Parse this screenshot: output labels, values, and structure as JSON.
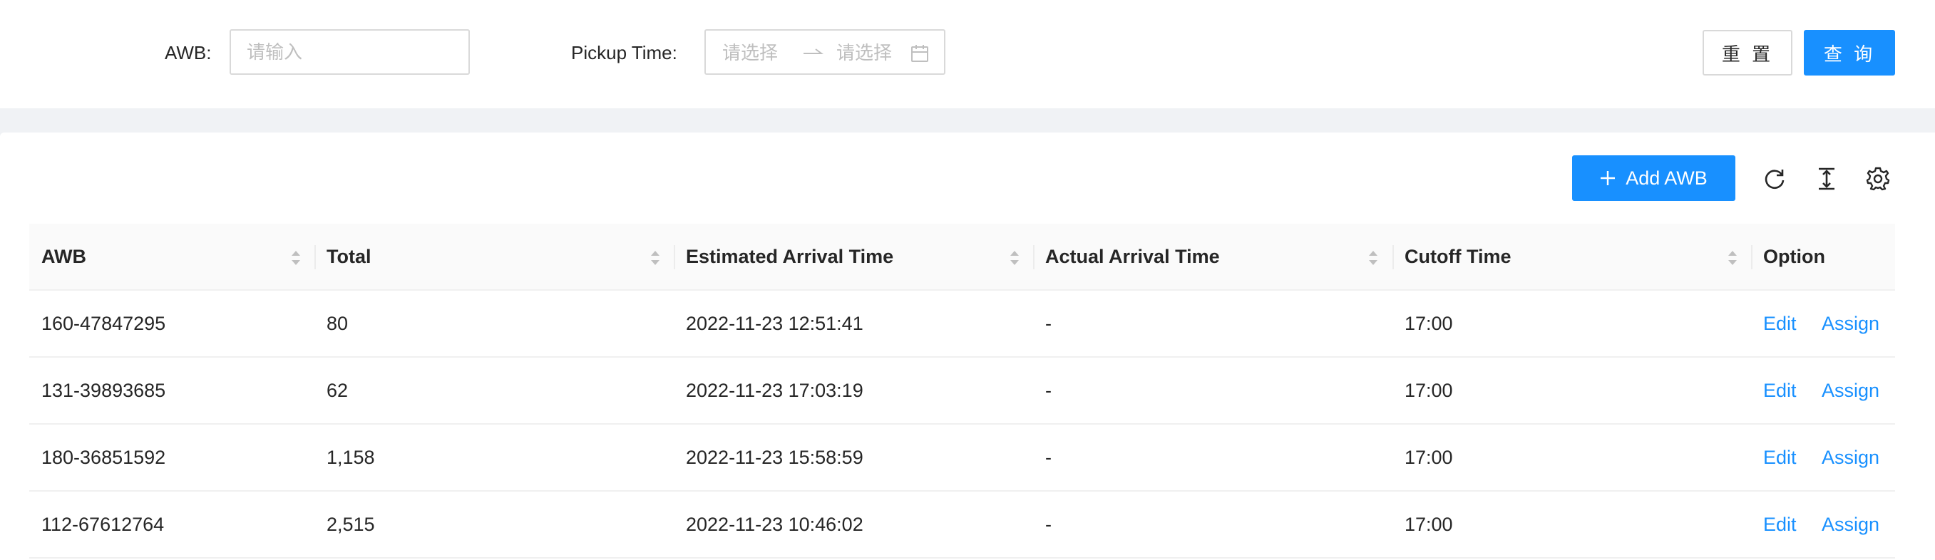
{
  "search": {
    "awb_label": "AWB:",
    "awb_placeholder": "请输入",
    "pickup_label": "Pickup Time:",
    "range_start_placeholder": "请选择",
    "range_end_placeholder": "请选择",
    "reset_label": "重 置",
    "query_label": "查 询"
  },
  "toolbar": {
    "add_label": "Add AWB",
    "icons": [
      "plus-icon",
      "reload-icon",
      "column-height-icon",
      "setting-icon"
    ]
  },
  "table": {
    "columns": [
      {
        "label": "AWB",
        "sortable": true
      },
      {
        "label": "Total",
        "sortable": true
      },
      {
        "label": "Estimated Arrival Time",
        "sortable": true
      },
      {
        "label": "Actual Arrival Time",
        "sortable": true
      },
      {
        "label": "Cutoff Time",
        "sortable": true
      },
      {
        "label": "Option",
        "sortable": false
      }
    ],
    "rows": [
      {
        "awb": "160-47847295",
        "total": "80",
        "eta": "2022-11-23 12:51:41",
        "ata": "-",
        "cutoff": "17:00",
        "edit": "Edit",
        "assign": "Assign"
      },
      {
        "awb": "131-39893685",
        "total": "62",
        "eta": "2022-11-23 17:03:19",
        "ata": "-",
        "cutoff": "17:00",
        "edit": "Edit",
        "assign": "Assign"
      },
      {
        "awb": "180-36851592",
        "total": "1,158",
        "eta": "2022-11-23 15:58:59",
        "ata": "-",
        "cutoff": "17:00",
        "edit": "Edit",
        "assign": "Assign"
      },
      {
        "awb": "112-67612764",
        "total": "2,515",
        "eta": "2022-11-23 10:46:02",
        "ata": "-",
        "cutoff": "17:00",
        "edit": "Edit",
        "assign": "Assign"
      }
    ]
  },
  "colors": {
    "primary": "#1890ff",
    "background": "#f0f2f5",
    "border": "#d9d9d9",
    "placeholder": "#bfbfbf"
  }
}
